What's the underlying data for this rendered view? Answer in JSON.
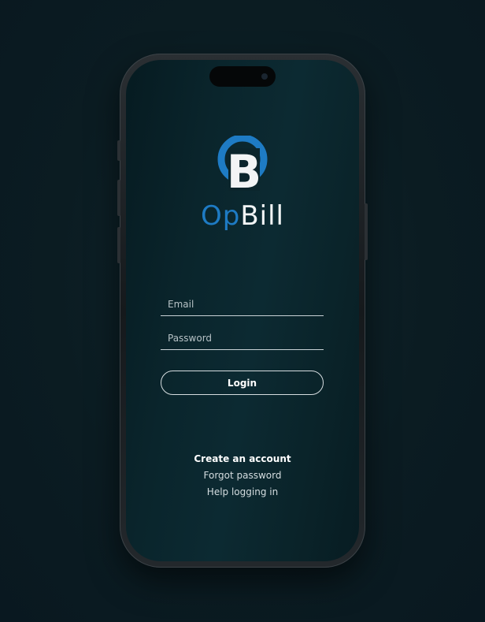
{
  "app": {
    "brand_prefix": "Op",
    "brand_suffix": "Bill",
    "logo_letter": "B",
    "brand_blue": "#1e7bc4"
  },
  "login_form": {
    "email_placeholder": "Email",
    "email_value": "",
    "password_placeholder": "Password",
    "password_value": "",
    "login_label": "Login"
  },
  "links": {
    "create_account": "Create an account",
    "forgot_password": "Forgot password",
    "help_logging_in": "Help logging in"
  }
}
